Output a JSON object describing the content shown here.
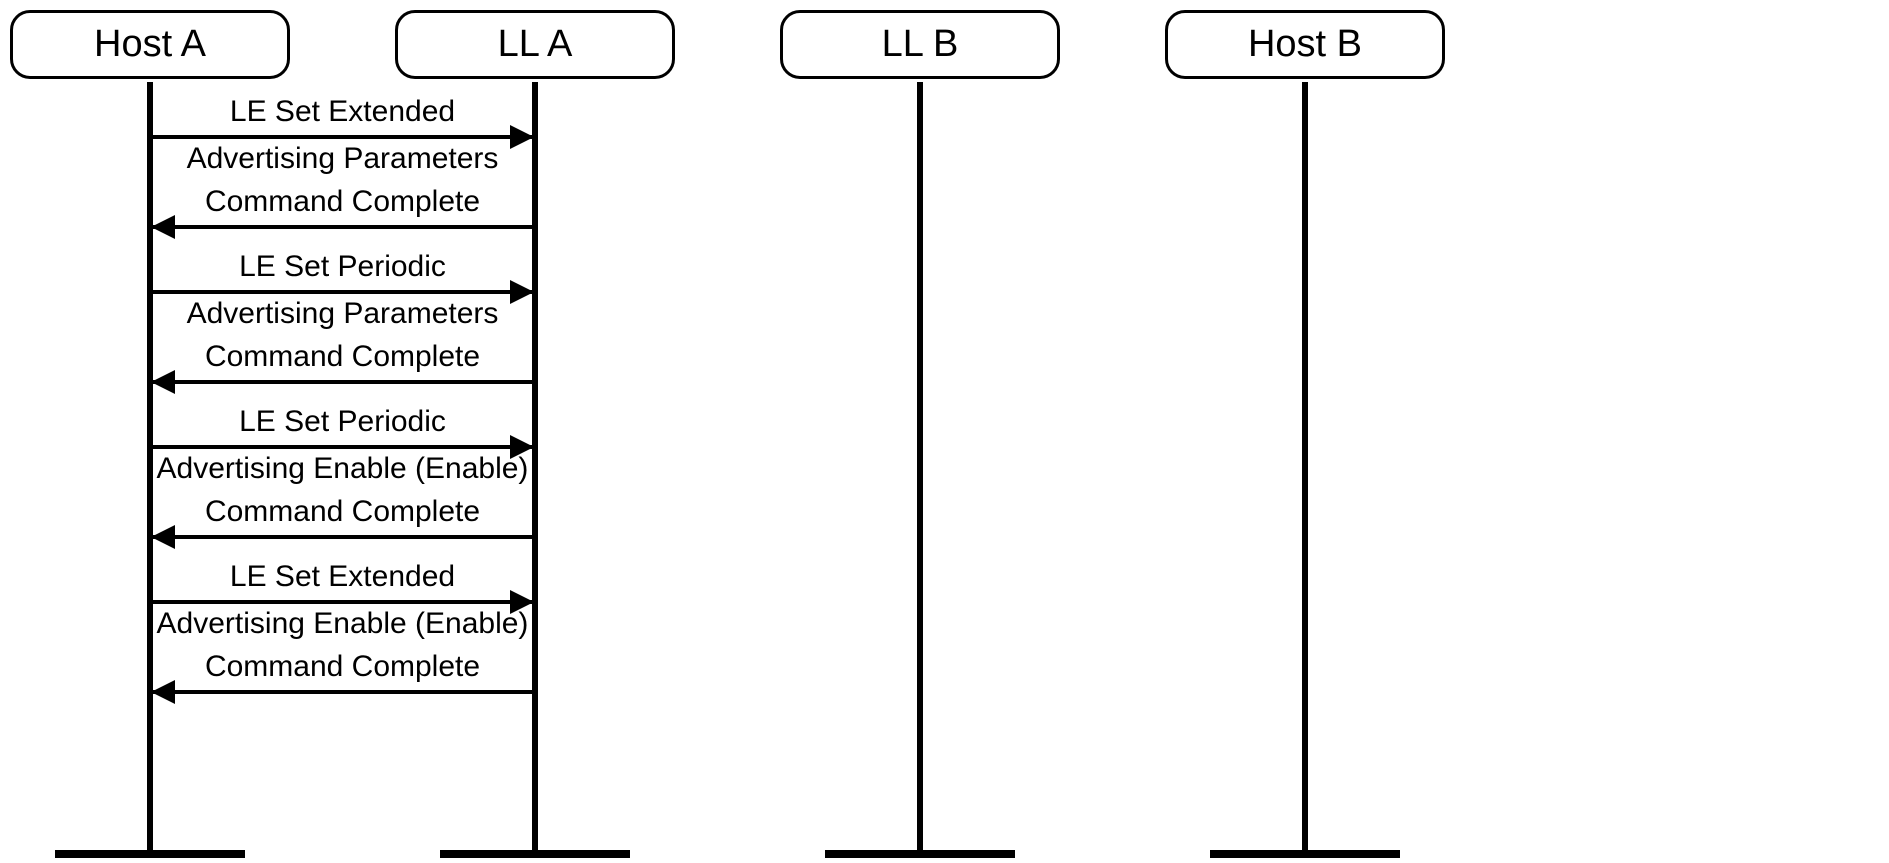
{
  "participants": {
    "hostA": {
      "label": "Host A"
    },
    "llA": {
      "label": "LL A"
    },
    "llB": {
      "label": "LL B"
    },
    "hostB": {
      "label": "Host B"
    }
  },
  "messages": {
    "m1": {
      "line1": "LE Set Extended",
      "line2": "Advertising Parameters"
    },
    "m2": {
      "line1": "Command Complete"
    },
    "m3": {
      "line1": "LE Set Periodic",
      "line2": "Advertising Parameters"
    },
    "m4": {
      "line1": "Command Complete"
    },
    "m5": {
      "line1": "LE Set Periodic",
      "line2": "Advertising Enable (Enable)"
    },
    "m6": {
      "line1": "Command Complete"
    },
    "m7": {
      "line1": "LE Set Extended",
      "line2": "Advertising Enable (Enable)"
    },
    "m8": {
      "line1": "Command Complete"
    }
  }
}
